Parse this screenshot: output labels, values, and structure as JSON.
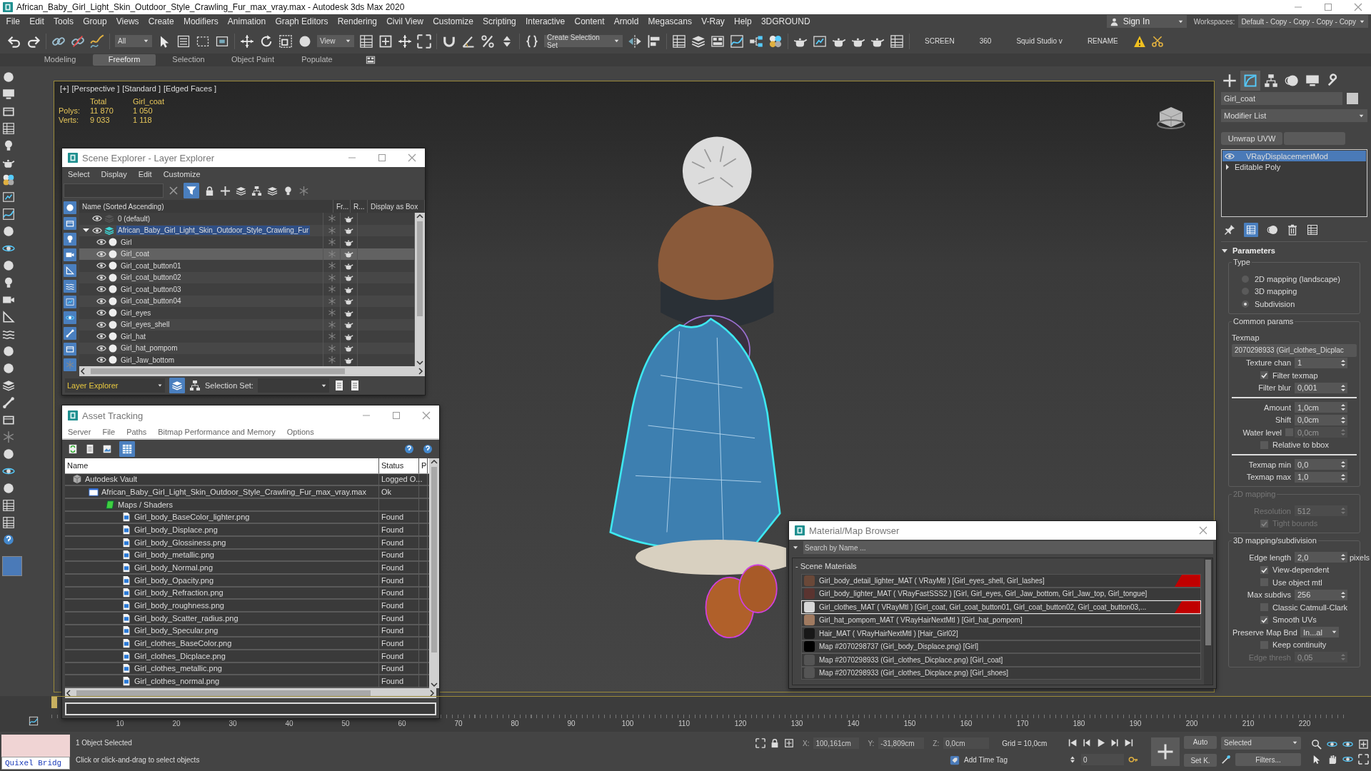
{
  "window": {
    "title": "African_Baby_Girl_Light_Skin_Outdoor_Style_Crawling_Fur_max_vray.max - Autodesk 3ds Max 2020"
  },
  "menu": [
    "File",
    "Edit",
    "Tools",
    "Group",
    "Views",
    "Create",
    "Modifiers",
    "Animation",
    "Graph Editors",
    "Rendering",
    "Civil View",
    "Customize",
    "Scripting",
    "Interactive",
    "Content",
    "Arnold",
    "Megascans",
    "V-Ray",
    "Help",
    "3DGROUND"
  ],
  "sign_in": "Sign In",
  "workspaces": {
    "label": "Workspaces:",
    "value": "Default - Copy - Copy - Copy - Copy"
  },
  "toolbar": {
    "filter": "All",
    "reference": "View",
    "selection_set": "Create Selection Set",
    "labels": [
      "SCREEN",
      "360",
      "Squid Studio v",
      "RENAME"
    ]
  },
  "ribbon_tabs": [
    {
      "label": "Modeling",
      "selected": false
    },
    {
      "label": "Freeform",
      "selected": true
    },
    {
      "label": "Selection",
      "selected": false
    },
    {
      "label": "Object Paint",
      "selected": false
    },
    {
      "label": "Populate",
      "selected": false
    }
  ],
  "viewport": {
    "labels": [
      "[+]",
      "[Perspective ]",
      "[Standard ]",
      "[Edged Faces ]"
    ],
    "stats": {
      "columns": [
        "Total",
        "Girl_coat"
      ],
      "rows": [
        {
          "label": "Polys:",
          "values": [
            "11 870",
            "1 050"
          ]
        },
        {
          "label": "Verts:",
          "values": [
            "9 033",
            "1 118"
          ]
        }
      ]
    }
  },
  "scene_explorer": {
    "title": "Scene Explorer - Layer Explorer",
    "menu": [
      "Select",
      "Display",
      "Edit",
      "Customize"
    ],
    "columns": [
      "Name (Sorted Ascending)",
      "Fr...",
      "R...",
      "Display as Box"
    ],
    "layers": [
      {
        "name": "0 (default)",
        "active": false,
        "selected": false
      },
      {
        "name": "African_Baby_Girl_Light_Skin_Outdoor_Style_Crawling_Fur",
        "active": true,
        "selected": false,
        "expanded": true,
        "children": [
          {
            "name": "Girl",
            "selected": false
          },
          {
            "name": "Girl_coat",
            "selected": true
          },
          {
            "name": "Girl_coat_button01",
            "selected": false
          },
          {
            "name": "Girl_coat_button02",
            "selected": false
          },
          {
            "name": "Girl_coat_button03",
            "selected": false
          },
          {
            "name": "Girl_coat_button04",
            "selected": false
          },
          {
            "name": "Girl_eyes",
            "selected": false
          },
          {
            "name": "Girl_eyes_shell",
            "selected": false
          },
          {
            "name": "Girl_hat",
            "selected": false
          },
          {
            "name": "Girl_hat_pompom",
            "selected": false
          },
          {
            "name": "Girl_Jaw_bottom",
            "selected": false
          }
        ]
      }
    ],
    "explorer_type": "Layer Explorer",
    "selection_set_label": "Selection Set:"
  },
  "asset_tracking": {
    "title": "Asset Tracking",
    "menu": [
      "Server",
      "File",
      "Paths",
      "Bitmap Performance and Memory",
      "Options"
    ],
    "columns": [
      "Name",
      "Status",
      "P"
    ],
    "rows": [
      {
        "kind": "vault",
        "name": "Autodesk Vault",
        "status": "Logged O...",
        "children": [
          {
            "kind": "scene",
            "name": "African_Baby_Girl_Light_Skin_Outdoor_Style_Crawling_Fur_max_vray.max",
            "status": "Ok",
            "children": [
              {
                "kind": "folder",
                "name": "Maps / Shaders",
                "children": [
                  {
                    "kind": "bitmap",
                    "name": "Girl_body_BaseColor_lighter.png",
                    "status": "Found"
                  },
                  {
                    "kind": "bitmap",
                    "name": "Girl_body_Displace.png",
                    "status": "Found"
                  },
                  {
                    "kind": "bitmap",
                    "name": "Girl_body_Glossiness.png",
                    "status": "Found"
                  },
                  {
                    "kind": "bitmap",
                    "name": "Girl_body_metallic.png",
                    "status": "Found"
                  },
                  {
                    "kind": "bitmap",
                    "name": "Girl_body_Normal.png",
                    "status": "Found"
                  },
                  {
                    "kind": "bitmap",
                    "name": "Girl_body_Opacity.png",
                    "status": "Found"
                  },
                  {
                    "kind": "bitmap",
                    "name": "Girl_body_Refraction.png",
                    "status": "Found"
                  },
                  {
                    "kind": "bitmap",
                    "name": "Girl_body_roughness.png",
                    "status": "Found"
                  },
                  {
                    "kind": "bitmap",
                    "name": "Girl_body_Scatter_radius.png",
                    "status": "Found"
                  },
                  {
                    "kind": "bitmap",
                    "name": "Girl_body_Specular.png",
                    "status": "Found"
                  },
                  {
                    "kind": "bitmap",
                    "name": "Girl_clothes_BaseColor.png",
                    "status": "Found"
                  },
                  {
                    "kind": "bitmap",
                    "name": "Girl_clothes_Dicplace.png",
                    "status": "Found"
                  },
                  {
                    "kind": "bitmap",
                    "name": "Girl_clothes_metallic.png",
                    "status": "Found"
                  },
                  {
                    "kind": "bitmap",
                    "name": "Girl_clothes_normal.png",
                    "status": "Found"
                  }
                ]
              }
            ]
          }
        ]
      }
    ]
  },
  "material_browser": {
    "title": "Material/Map Browser",
    "search_placeholder": "Search by Name ...",
    "group": "- Scene Materials",
    "items": [
      {
        "text": "Girl_body_detail_lighter_MAT ( VRayMtl ) [Girl_eyes_shell, Girl_lashes]",
        "color": "#6a4838",
        "selected": false,
        "flagged": true
      },
      {
        "text": "Girl_body_lighter_MAT ( VRayFastSSS2 ) [Girl, Girl_eyes, Girl_Jaw_bottom, Girl_Jaw_top, Girl_tongue]",
        "color": "#5a3430",
        "selected": false,
        "flagged": false
      },
      {
        "text": "Girl_clothes_MAT ( VRayMtl ) [Girl_coat, Girl_coat_button01, Girl_coat_button02, Girl_coat_button03,...",
        "color": "#d8d8d8",
        "selected": true,
        "flagged": true
      },
      {
        "text": "Girl_hat_pompom_MAT ( VRayHairNextMtl ) [Girl_hat_pompom]",
        "color": "#a07a60",
        "selected": false,
        "flagged": false
      },
      {
        "text": "Hair_MAT ( VRayHairNextMtl ) [Hair_Girl02]",
        "color": "#181818",
        "selected": false,
        "flagged": false
      },
      {
        "text": "Map #2070298737 (Girl_body_Displace.png) [Girl]",
        "color": "#000000",
        "selected": false,
        "flagged": false
      },
      {
        "text": "Map #2070298933 (Girl_clothes_Dicplace.png) [Girl_coat]",
        "color": "#555555",
        "selected": false,
        "flagged": false
      },
      {
        "text": "Map #2070298933 (Girl_clothes_Dicplace.png) [Girl_shoes]",
        "color": "#555555",
        "selected": false,
        "flagged": false
      }
    ]
  },
  "command_panel": {
    "object_name": "Girl_coat",
    "modifier_list": "Modifier List",
    "modifier_buttons": [
      "Unwrap UVW"
    ],
    "stack": [
      {
        "label": "VRayDisplacementMod",
        "selected": true,
        "kind": "modifier"
      },
      {
        "label": "Editable Poly",
        "selected": false,
        "kind": "base"
      }
    ],
    "rollout": "Parameters",
    "groups": [
      {
        "title": "Type",
        "disabled": false,
        "items": [
          {
            "kind": "radio",
            "label": "2D mapping (landscape)",
            "selected": false
          },
          {
            "kind": "radio",
            "label": "3D mapping",
            "selected": false
          },
          {
            "kind": "radio",
            "label": "Subdivision",
            "selected": true
          }
        ]
      },
      {
        "title": "Common params",
        "disabled": false,
        "items": [
          {
            "kind": "label",
            "label": "Texmap"
          },
          {
            "kind": "button",
            "label": "2070298933 (Girl_clothes_Dicplac"
          },
          {
            "kind": "spinner",
            "label": "Texture chan",
            "value": "1"
          },
          {
            "kind": "check",
            "label": "Filter texmap",
            "checked": true
          },
          {
            "kind": "spinner",
            "label": "Filter blur",
            "value": "0,001"
          },
          {
            "kind": "rule"
          },
          {
            "kind": "spinner",
            "label": "Amount",
            "value": "1,0cm"
          },
          {
            "kind": "spinner",
            "label": "Shift",
            "value": "0,0cm"
          },
          {
            "kind": "checkspinner",
            "label": "Water level",
            "checked": false,
            "value": "0,0cm"
          },
          {
            "kind": "check",
            "label": "Relative to bbox",
            "checked": false
          },
          {
            "kind": "rule"
          },
          {
            "kind": "spinner",
            "label": "Texmap min",
            "value": "0,0"
          },
          {
            "kind": "spinner",
            "label": "Texmap max",
            "value": "1,0"
          }
        ]
      },
      {
        "title": "2D mapping",
        "disabled": true,
        "items": [
          {
            "kind": "spinner",
            "label": "Resolution",
            "value": "512"
          },
          {
            "kind": "check",
            "label": "Tight bounds",
            "checked": true
          }
        ]
      },
      {
        "title": "3D mapping/subdivision",
        "disabled": false,
        "items": [
          {
            "kind": "spinner",
            "label": "Edge length",
            "value": "2,0",
            "unit": "pixels"
          },
          {
            "kind": "check",
            "label": "View-dependent",
            "checked": true
          },
          {
            "kind": "check",
            "label": "Use object mtl",
            "checked": false
          },
          {
            "kind": "spinner",
            "label": "Max subdivs",
            "value": "256"
          },
          {
            "kind": "check",
            "label": "Classic Catmull-Clark",
            "checked": false
          },
          {
            "kind": "check",
            "label": "Smooth UVs",
            "checked": true
          },
          {
            "kind": "dropdown",
            "label": "Preserve Map Bnd",
            "value": "In...al"
          },
          {
            "kind": "check",
            "label": "Keep continuity",
            "checked": false
          },
          {
            "kind": "spinner",
            "label": "Edge thresh",
            "value": "0,05",
            "disabled": true
          }
        ]
      }
    ]
  },
  "timeline": {
    "ticks": [
      "10",
      "20",
      "30",
      "40",
      "50",
      "60",
      "70",
      "80",
      "90",
      "100",
      "110",
      "120",
      "130",
      "140",
      "150",
      "160",
      "170",
      "180",
      "190",
      "200",
      "210",
      "220"
    ]
  },
  "status": {
    "quixel": "Quixel Bridg",
    "selection": "1 Object Selected",
    "prompt": "Click or click-and-drag to select objects",
    "coords": [
      {
        "label": "X:",
        "value": "100,161cm"
      },
      {
        "label": "Y:",
        "value": "-31,809cm"
      },
      {
        "label": "Z:",
        "value": "0,0cm"
      }
    ],
    "grid": "Grid = 10,0cm",
    "time_tag": "Add Time Tag",
    "frame": "0",
    "auto_key": "Auto",
    "set_key": "Set K.",
    "key_filter": "Selected",
    "filters": "Filters..."
  }
}
